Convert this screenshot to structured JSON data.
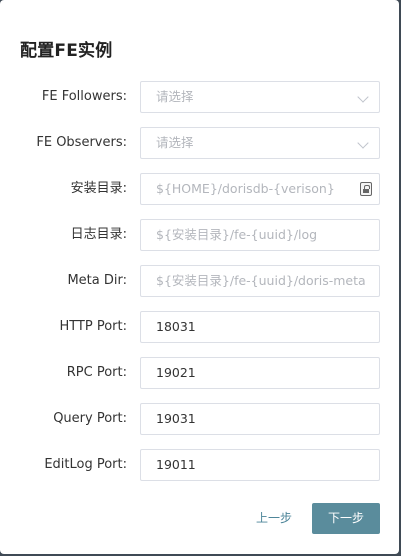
{
  "dialog": {
    "title": "配置FE实例",
    "fields": [
      {
        "label": "FE Followers:",
        "value": "",
        "placeholder": "请选择",
        "type": "select"
      },
      {
        "label": "FE Observers:",
        "value": "",
        "placeholder": "请选择",
        "type": "select"
      },
      {
        "label": "安装目录:",
        "value": "",
        "placeholder": "${HOME}/dorisdb-{verison}",
        "type": "text"
      },
      {
        "label": "日志目录:",
        "value": "",
        "placeholder": "${安装目录}/fe-{uuid}/log",
        "type": "text"
      },
      {
        "label": "Meta Dir:",
        "value": "",
        "placeholder": "${安装目录}/fe-{uuid}/doris-meta",
        "type": "text"
      },
      {
        "label": "HTTP Port:",
        "value": "18031",
        "placeholder": "",
        "type": "text"
      },
      {
        "label": "RPC Port:",
        "value": "19021",
        "placeholder": "",
        "type": "text"
      },
      {
        "label": "Query Port:",
        "value": "19031",
        "placeholder": "",
        "type": "text"
      },
      {
        "label": "EditLog Port:",
        "value": "19011",
        "placeholder": "",
        "type": "text"
      }
    ],
    "prev_label": "上一步",
    "next_label": "下一步"
  },
  "colors": {
    "primary_button": "#5a8c9c",
    "link": "#4d8599",
    "placeholder": "#b3b6bc",
    "backdrop": "#3f4a55"
  },
  "icons": {
    "select_arrow": "chevron-down-icon",
    "install_dir_helper": "lock-icon"
  }
}
